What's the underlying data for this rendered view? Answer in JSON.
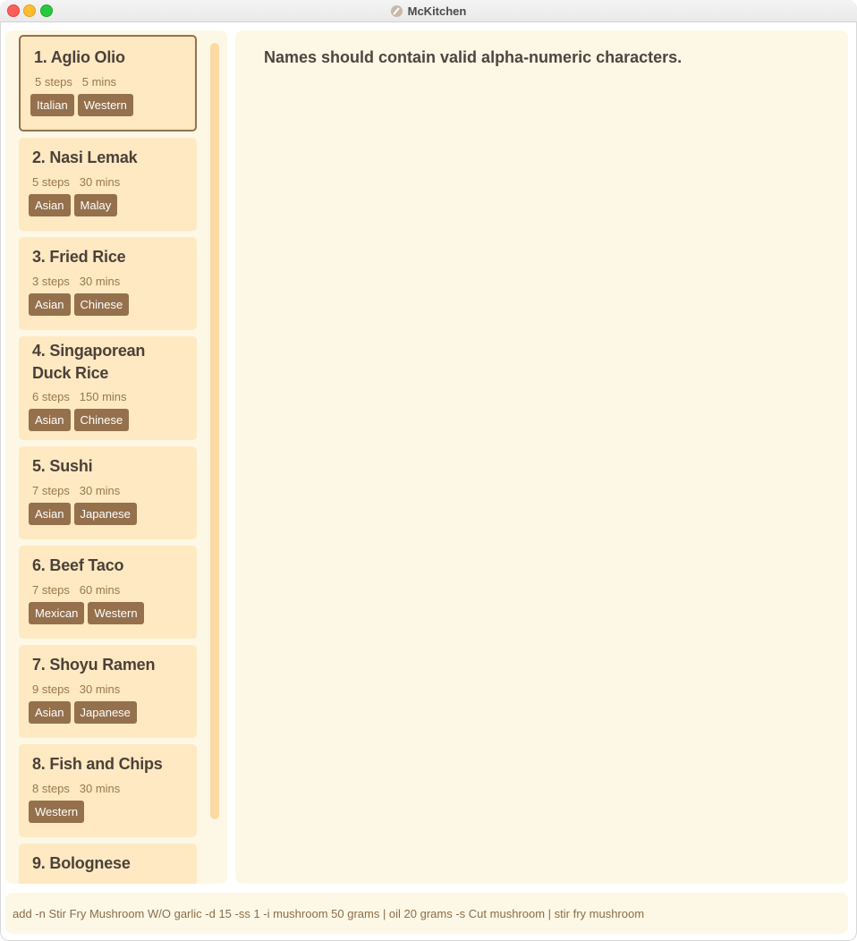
{
  "window": {
    "title": "McKitchen"
  },
  "recipes": [
    {
      "title": "1. Aglio Olio",
      "steps": "5 steps",
      "time": "5 mins",
      "tags": [
        "Italian",
        "Western"
      ]
    },
    {
      "title": "2. Nasi Lemak",
      "steps": "5 steps",
      "time": "30 mins",
      "tags": [
        "Asian",
        "Malay"
      ]
    },
    {
      "title": "3. Fried Rice",
      "steps": "3 steps",
      "time": "30 mins",
      "tags": [
        "Asian",
        "Chinese"
      ]
    },
    {
      "title": "4. Singaporean Duck Rice",
      "steps": "6 steps",
      "time": "150 mins",
      "tags": [
        "Asian",
        "Chinese"
      ]
    },
    {
      "title": "5. Sushi",
      "steps": "7 steps",
      "time": "30 mins",
      "tags": [
        "Asian",
        "Japanese"
      ]
    },
    {
      "title": "6. Beef Taco",
      "steps": "7 steps",
      "time": "60 mins",
      "tags": [
        "Mexican",
        "Western"
      ]
    },
    {
      "title": "7. Shoyu Ramen",
      "steps": "9 steps",
      "time": "30 mins",
      "tags": [
        "Asian",
        "Japanese"
      ]
    },
    {
      "title": "8. Fish and Chips",
      "steps": "8 steps",
      "time": "30 mins",
      "tags": [
        "Western"
      ]
    },
    {
      "title": "9. Bolognese"
    }
  ],
  "result": {
    "message": "Names should contain valid alpha-numeric characters."
  },
  "command": {
    "value": "add -n Stir Fry Mushroom W/O garlic -d 15 -ss 1 -i mushroom 50 grams | oil 20 grams -s Cut mushroom | stir fry mushroom"
  },
  "colors": {
    "panel_bg": "#fdf8e5",
    "card_bg": "#fee9c2",
    "tag_bg": "#94704c",
    "scrollbar": "#fdd9a5"
  }
}
